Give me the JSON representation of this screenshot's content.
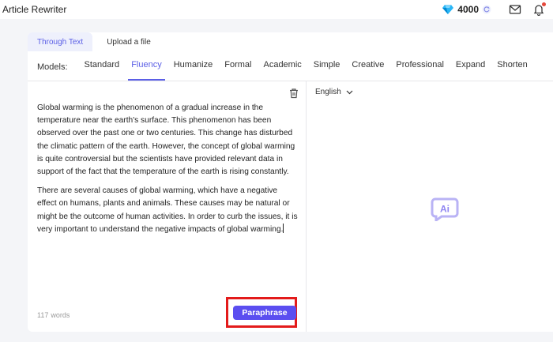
{
  "app": {
    "title": "Article Rewriter"
  },
  "header": {
    "credits": "4000",
    "icons": [
      "diamond-icon",
      "refresh-icon",
      "mail-icon",
      "bell-icon"
    ],
    "notification_color": "#e5483b"
  },
  "tabs": [
    {
      "label": "Through Text",
      "active": true
    },
    {
      "label": "Upload a file",
      "active": false
    }
  ],
  "models": {
    "label": "Models:",
    "items": [
      "Standard",
      "Fluency",
      "Humanize",
      "Formal",
      "Academic",
      "Simple",
      "Creative",
      "Professional",
      "Expand",
      "Shorten"
    ],
    "selected": "Fluency"
  },
  "editor": {
    "paragraphs": [
      "Global warming is the phenomenon of a gradual increase in the temperature near the earth's surface. This phenomenon has been observed over the past one or two centuries. This change has disturbed the climatic pattern of the earth. However, the concept of global warming is quite controversial but the scientists have provided relevant data in support of the fact that the temperature of the earth is rising constantly.",
      "There are several causes of global warming, which have a negative effect on humans, plants and animals. These causes may be natural or might be the outcome of human activities. In order to curb the issues, it is very important to understand the negative impacts of global warming."
    ],
    "word_count": "117",
    "word_label": "words",
    "paraphrase_label": "Paraphrase"
  },
  "output": {
    "language": "English",
    "logo_text": "Ai"
  },
  "colors": {
    "accent": "#5b5fe6",
    "button": "#5b4ef0",
    "highlight": "#e31b1b"
  }
}
